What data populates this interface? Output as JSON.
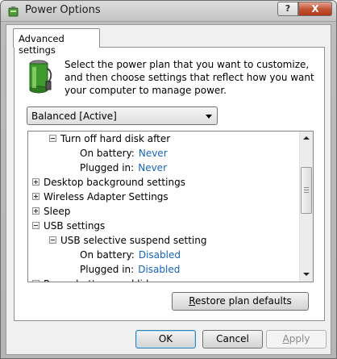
{
  "window": {
    "title": "Power Options",
    "help_glyph": "?",
    "close_glyph": "X"
  },
  "tab": {
    "label": "Advanced settings"
  },
  "description": "Select the power plan that you want to customize, and then choose settings that reflect how you want your computer to manage power.",
  "plan_select": {
    "value": "Balanced [Active]"
  },
  "tree": {
    "rows": [
      {
        "text": "Turn off hard disk after",
        "value": "",
        "expander": "minus",
        "level": 1
      },
      {
        "text": "On battery:",
        "value": "Never",
        "expander": "",
        "level": 2
      },
      {
        "text": "Plugged in:",
        "value": "Never",
        "expander": "",
        "level": 2
      },
      {
        "text": "Desktop background settings",
        "value": "",
        "expander": "plus",
        "level": 0
      },
      {
        "text": "Wireless Adapter Settings",
        "value": "",
        "expander": "plus",
        "level": 0
      },
      {
        "text": "Sleep",
        "value": "",
        "expander": "plus",
        "level": 0
      },
      {
        "text": "USB settings",
        "value": "",
        "expander": "minus",
        "level": 0
      },
      {
        "text": "USB selective suspend setting",
        "value": "",
        "expander": "minus",
        "level": 1
      },
      {
        "text": "On battery:",
        "value": "Disabled",
        "expander": "",
        "level": 2
      },
      {
        "text": "Plugged in:",
        "value": "Disabled",
        "expander": "",
        "level": 2
      },
      {
        "text": "Power buttons and lid",
        "value": "",
        "expander": "plus",
        "level": 0
      }
    ]
  },
  "buttons": {
    "restore": {
      "prefix": "",
      "accel": "R",
      "rest": "estore plan defaults"
    },
    "ok": "OK",
    "cancel": "Cancel",
    "apply": {
      "prefix": "",
      "accel": "A",
      "rest": "pply"
    }
  },
  "colors": {
    "value_link": "#1564c0",
    "close_button": "#c45536"
  }
}
